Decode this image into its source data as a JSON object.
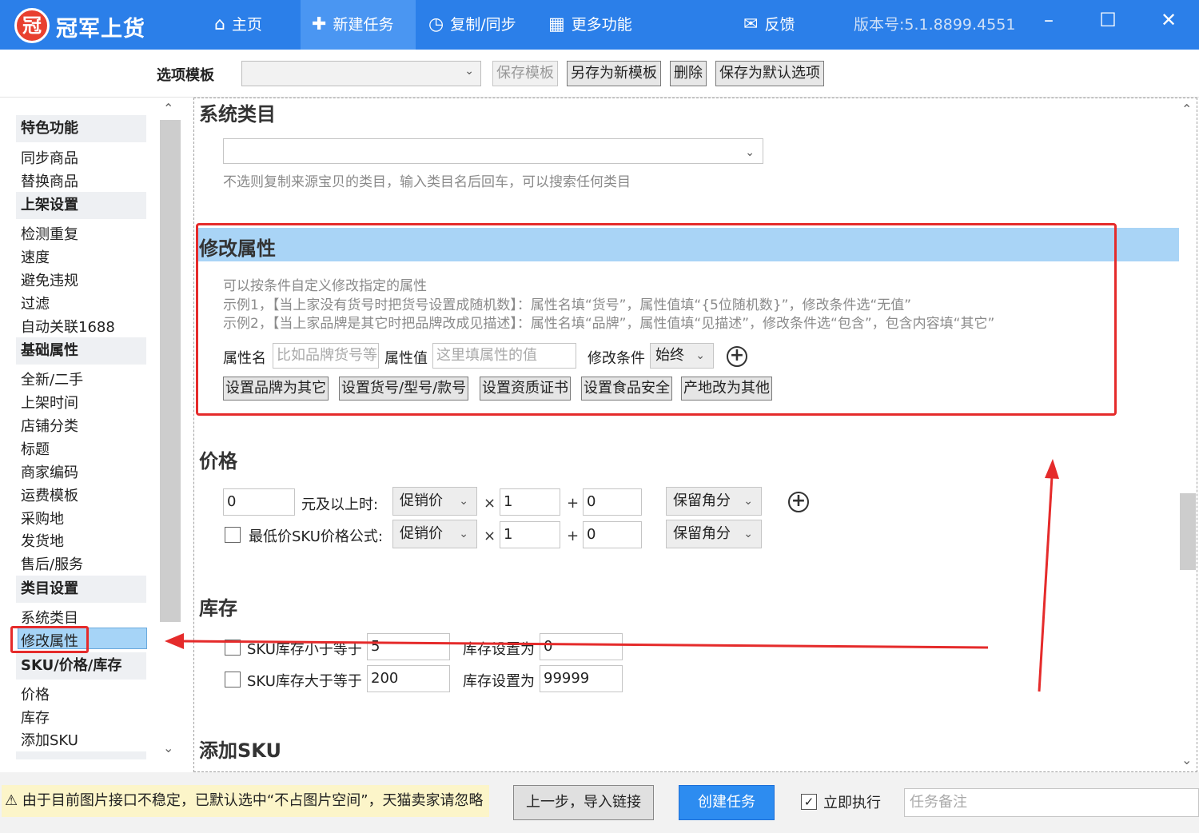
{
  "app": {
    "logo_text": "冠",
    "name": "冠军上货",
    "nav": [
      {
        "label": "主页",
        "icon": "home-icon",
        "glyph": "⌂"
      },
      {
        "label": "新建任务",
        "icon": "new-task-icon",
        "glyph": "✚"
      },
      {
        "label": "复制/同步",
        "icon": "clock-icon",
        "glyph": "◷"
      },
      {
        "label": "更多功能",
        "icon": "grid-icon",
        "glyph": "▦"
      },
      {
        "label": "反馈",
        "icon": "feedback-icon",
        "glyph": "✉"
      }
    ],
    "version": "版本号:5.1.8899.4551",
    "window": {
      "minimize": "–",
      "maximize": "☐",
      "close": "✕"
    }
  },
  "toolbar": {
    "template_label": "选项模板",
    "template_value": "",
    "save_template": "保存模板",
    "save_as_new": "另存为新模板",
    "delete": "删除",
    "save_default": "保存为默认选项"
  },
  "sidebar": {
    "groups": [
      {
        "title": "特色功能",
        "items": [
          "同步商品",
          "替换商品"
        ]
      },
      {
        "title": "上架设置",
        "items": [
          "检测重复",
          "速度",
          "避免违规",
          "过滤",
          "自动关联1688"
        ]
      },
      {
        "title": "基础属性",
        "items": [
          "全新/二手",
          "上架时间",
          "店铺分类",
          "标题",
          "商家编码",
          "运费模板",
          "采购地",
          "发货地",
          "售后/服务"
        ]
      },
      {
        "title": "类目设置",
        "items": [
          "系统类目",
          "修改属性"
        ]
      },
      {
        "title": "SKU/价格/库存",
        "items": [
          "价格",
          "库存",
          "添加SKU"
        ]
      }
    ],
    "selected": "修改属性"
  },
  "main": {
    "system_category": {
      "title": "系统类目",
      "select_value": "",
      "hint": "不选则复制来源宝贝的类目，输入类目名后回车，可以搜索任何类目"
    },
    "modify_attr": {
      "title": "修改属性",
      "desc": [
        "可以按条件自定义修改指定的属性",
        "示例1，【当上家没有货号时把货号设置成随机数】：属性名填“货号”，属性值填“{5位随机数}”，修改条件选“无值”",
        "示例2，【当上家品牌是其它时把品牌改成见描述】：属性名填“品牌”，属性值填“见描述”，修改条件选“包含”，包含内容填“其它”"
      ],
      "name_label": "属性名",
      "name_placeholder": "比如品牌货号等",
      "value_label": "属性值",
      "value_placeholder": "这里填属性的值",
      "cond_label": "修改条件",
      "cond_value": "始终",
      "buttons": [
        "设置品牌为其它",
        "设置货号/型号/款号",
        "设置资质证书",
        "设置食品安全",
        "产地改为其他"
      ]
    },
    "price": {
      "title": "价格",
      "row1": {
        "amount": "0",
        "label": "元及以上时:",
        "base": "促销价",
        "mul_op": "×",
        "mul": "1",
        "add_op": "+",
        "add": "0",
        "round": "保留角分"
      },
      "row2": {
        "label": "最低价SKU价格公式:",
        "base": "促销价",
        "mul_op": "×",
        "mul": "1",
        "add_op": "+",
        "add": "0",
        "round": "保留角分"
      }
    },
    "stock": {
      "title": "库存",
      "row1": {
        "label": "SKU库存小于等于",
        "threshold": "5",
        "set_label": "库存设置为",
        "set_value": "0"
      },
      "row2": {
        "label": "SKU库存大于等于",
        "threshold": "200",
        "set_label": "库存设置为",
        "set_value": "99999"
      }
    },
    "add_sku": {
      "title": "添加SKU"
    }
  },
  "bottom": {
    "warning": "由于目前图片接口不稳定，已默认选中“不占图片空间”，天猫卖家请忽略",
    "warning_icon": "⚠",
    "prev": "上一步，导入链接",
    "create": "创建任务",
    "exec_label": "立即执行",
    "exec_checked": true,
    "note_placeholder": "任务备注"
  },
  "colors": {
    "brand": "#2b7fe9",
    "highlight": "#a9d4f6",
    "annotation": "#e52b2b",
    "primary_button": "#2d8cf0"
  }
}
